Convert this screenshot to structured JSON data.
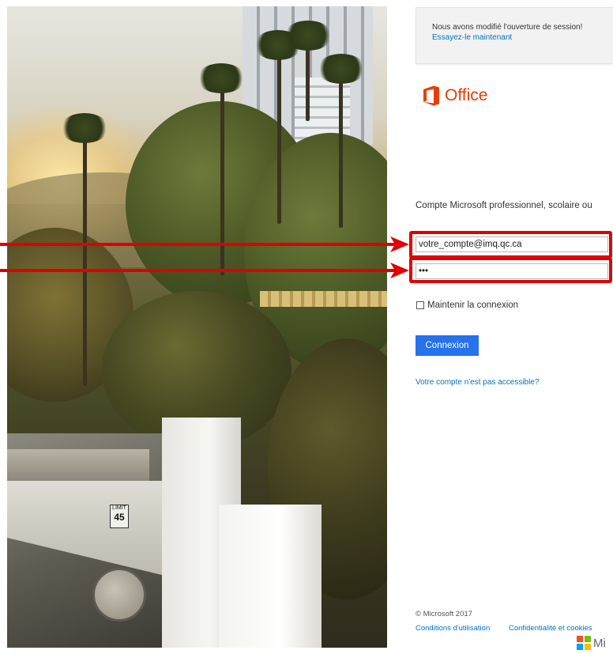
{
  "notice": {
    "text": "Nous avons modifié l'ouverture de session!",
    "link": "Essayez-le maintenant"
  },
  "brand": {
    "product_name": "Office",
    "icon": "office-logo-icon",
    "color": "#eb3c00"
  },
  "form": {
    "account_label": "Compte Microsoft professionnel, scolaire ou",
    "email_value": "votre_compte@imq.qc.ca",
    "password_value": "•••",
    "remember_label": "Maintenir la connexion",
    "remember_checked": false,
    "submit_label": "Connexion",
    "help_link": "Votre compte n'est pas accessible?"
  },
  "footer": {
    "copyright": "© Microsoft 2017",
    "terms": "Conditions d'utilisation",
    "privacy": "Confidentialité et cookies",
    "ms_logo_text": "Mi"
  },
  "hero": {
    "sign_top": "LIMIT",
    "sign_value": "45"
  },
  "annotations": {
    "highlight_color": "#e00000"
  },
  "colors": {
    "accent": "#2672ec",
    "link": "#0072c6"
  }
}
